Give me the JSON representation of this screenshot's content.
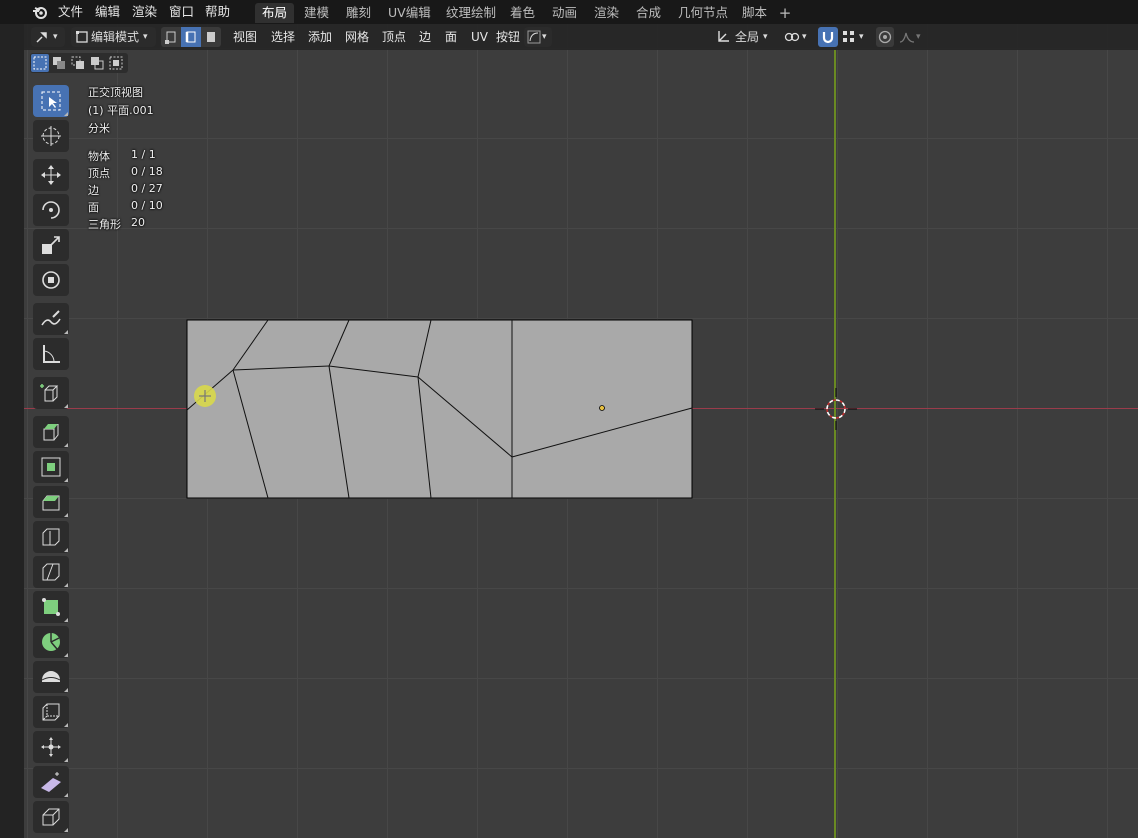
{
  "menu": {
    "items": [
      "文件",
      "编辑",
      "渲染",
      "窗口",
      "帮助"
    ]
  },
  "workspaces": {
    "tabs": [
      "布局",
      "建模",
      "雕刻",
      "UV编辑",
      "纹理绘制",
      "着色",
      "动画",
      "渲染",
      "合成",
      "几何节点",
      "脚本"
    ],
    "active": "布局",
    "add_label": "+"
  },
  "header": {
    "mode_label": "编辑模式",
    "menus": [
      "视图",
      "选择",
      "添加",
      "网格",
      "顶点",
      "边",
      "面",
      "UV"
    ],
    "button_label": "按钮",
    "orientation_label": "全局"
  },
  "overlay": {
    "view_name": "正交顶视图",
    "object_name": "(1) 平面.001",
    "unit": "分米",
    "stats": [
      {
        "label": "物体",
        "value": "1 / 1"
      },
      {
        "label": "顶点",
        "value": "0 / 18"
      },
      {
        "label": "边",
        "value": "0 / 27"
      },
      {
        "label": "面",
        "value": "0 / 10"
      },
      {
        "label": "三角形",
        "value": "20"
      }
    ]
  },
  "tools": [
    "select-box-icon",
    "cursor-icon",
    "move-icon",
    "rotate-icon",
    "scale-icon",
    "transform-icon",
    "annotate-icon",
    "measure-icon",
    "add-cube-icon",
    "extrude-icon",
    "inset-icon",
    "bevel-icon",
    "loop-cut-icon",
    "knife-icon",
    "poly-build-icon",
    "spin-icon",
    "smooth-icon",
    "edge-slide-icon",
    "shrink-fatten-icon",
    "shear-icon",
    "rip-icon"
  ],
  "colors": {
    "viewport_bg": "#3d3d3d",
    "grid_line": "#474747",
    "x_axis": "#9a3c4b",
    "y_axis": "#6a8a22",
    "mesh_fill": "#a9a9a9",
    "mesh_edge": "#000000",
    "accent": "#4772b3",
    "cursor_yellow": "#d8d84a"
  }
}
